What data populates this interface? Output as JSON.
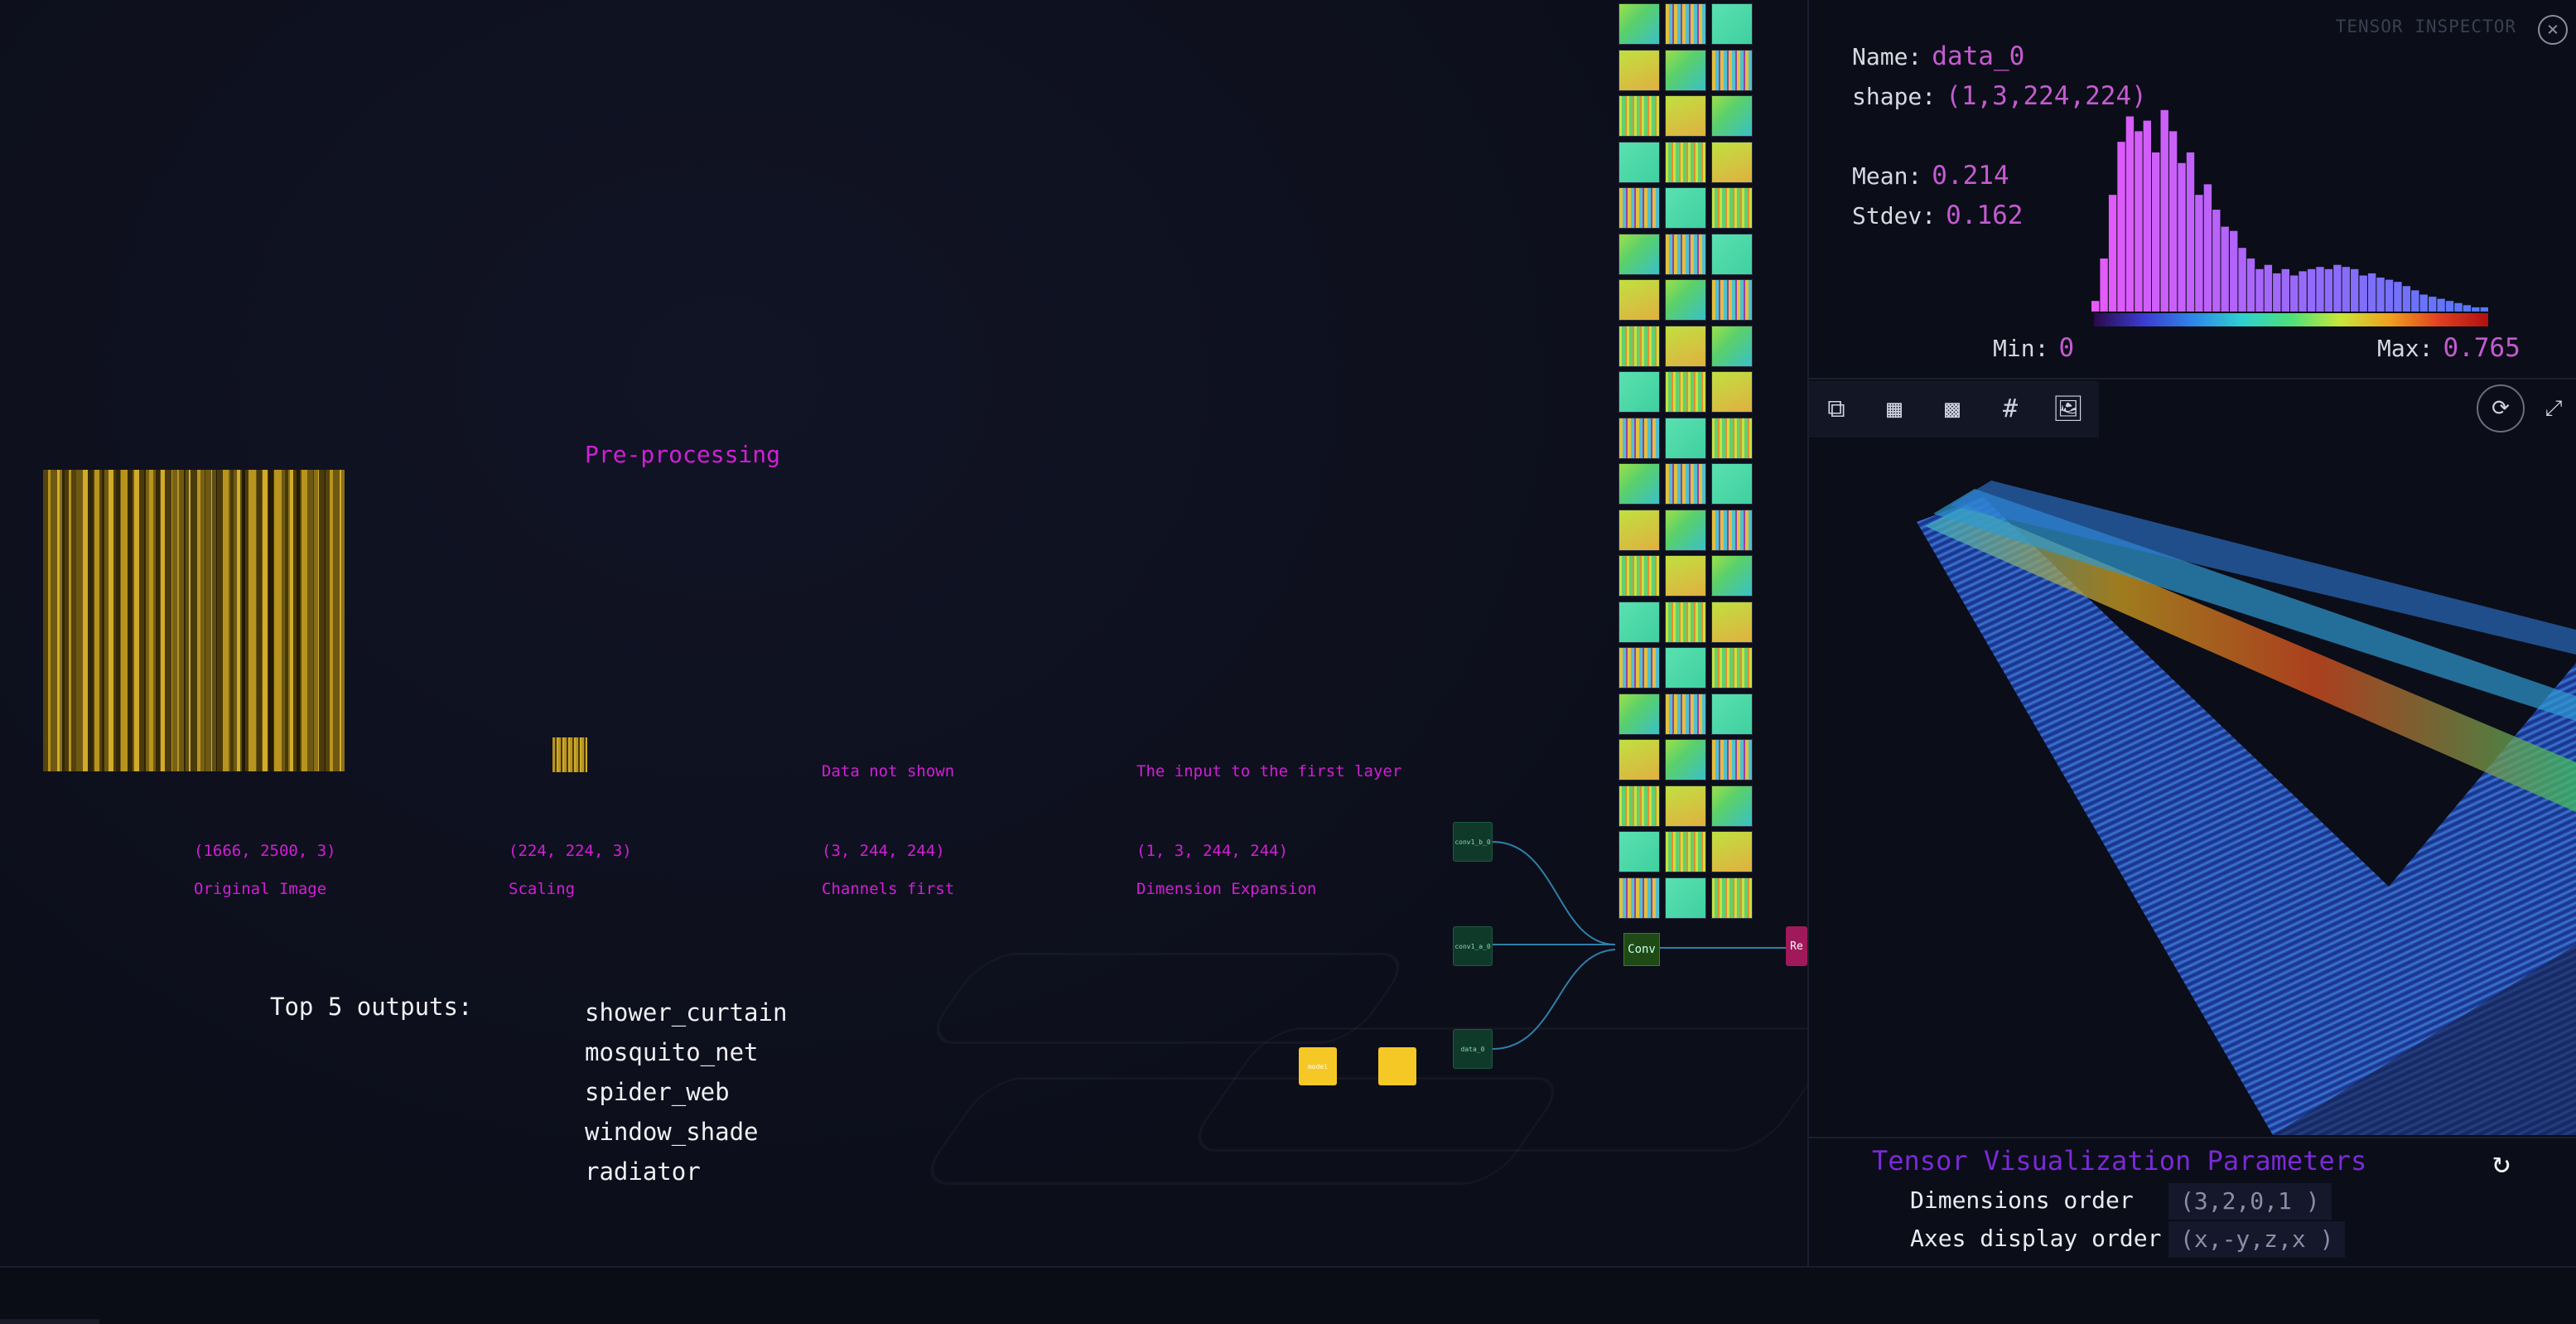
{
  "pipeline": {
    "title": "Pre-processing",
    "steps": [
      {
        "shape": "(1666, 2500, 3)",
        "name": "Original Image"
      },
      {
        "shape": "(224, 224, 3)",
        "name": "Scaling"
      },
      {
        "shape": "(3, 244, 244)",
        "name": "Channels first",
        "note": "Data not shown"
      },
      {
        "shape": "(1, 3, 244, 244)",
        "name": "Dimension Expansion",
        "note": "The input to the first layer"
      }
    ]
  },
  "outputs": {
    "label": "Top 5 outputs:",
    "items": [
      "shower_curtain",
      "mosquito_net",
      "spider_web",
      "window_shade",
      "radiator"
    ]
  },
  "graph": {
    "nodes": {
      "conv_b_2": "conv1_b_0",
      "conv_a_2": "conv1_a_0",
      "data_0": "data_0",
      "model_0": "model",
      "conv": "Conv",
      "relu": "Re"
    }
  },
  "inspector": {
    "title": "TENSOR INSPECTOR",
    "name_label": "Name:",
    "name_value": "data_0",
    "shape_label": "shape:",
    "shape_value": "(1,3,224,224)",
    "mean_label": "Mean:",
    "mean_value": "0.214",
    "stdev_label": "Stdev:",
    "stdev_value": "0.162",
    "min_label": "Min:",
    "min_value": "0",
    "max_label": "Max:",
    "max_value": "0.765",
    "histogram": [
      0.05,
      0.25,
      0.55,
      0.8,
      0.92,
      0.85,
      0.9,
      0.75,
      0.95,
      0.85,
      0.7,
      0.75,
      0.55,
      0.6,
      0.48,
      0.4,
      0.38,
      0.3,
      0.25,
      0.2,
      0.22,
      0.18,
      0.2,
      0.17,
      0.19,
      0.2,
      0.21,
      0.2,
      0.22,
      0.21,
      0.2,
      0.17,
      0.18,
      0.16,
      0.15,
      0.14,
      0.12,
      0.1,
      0.08,
      0.07,
      0.06,
      0.05,
      0.04,
      0.03,
      0.02,
      0.02
    ],
    "params": {
      "title": "Tensor Visualization Parameters",
      "dims_label": "Dimensions order",
      "dims_value": "(3,2,0,1 )",
      "axes_label": "Axes display order",
      "axes_value": "(x,-y,z,x )"
    },
    "colors": {
      "accent": "#d21fd6",
      "value": "#c45bd0",
      "params_title": "#7a2ad8"
    }
  }
}
